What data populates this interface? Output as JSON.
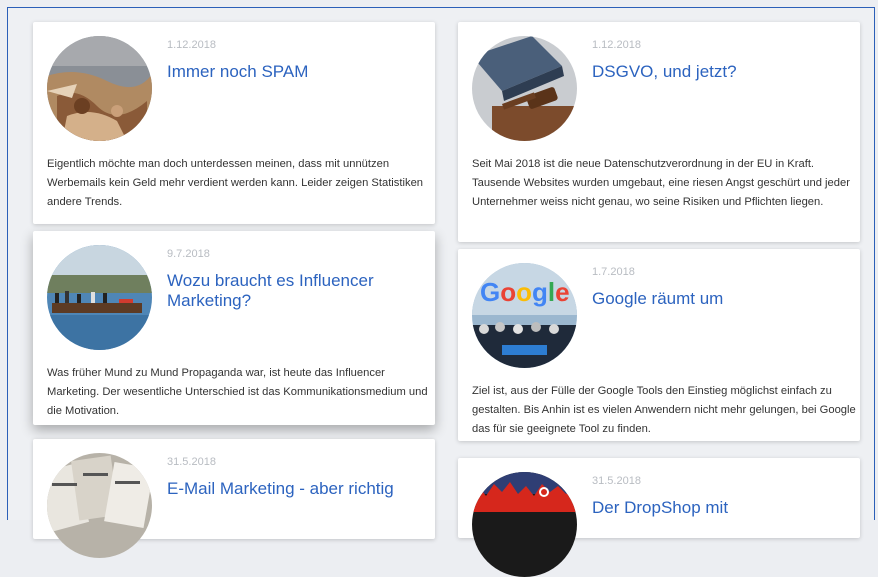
{
  "posts": [
    {
      "date": "1.12.2018",
      "title": "Immer noch SPAM",
      "excerpt": "Eigentlich möchte man doch unterdessen meinen, dass mit unnützen Werbemails kein Geld mehr verdient werden kann. Leider zeigen Statistiken andere Trends."
    },
    {
      "date": "1.12.2018",
      "title": "DSGVO, und jetzt?",
      "excerpt": "Seit Mai 2018 ist die neue Datenschutzverordnung in der EU in Kraft. Tausende Websites wurden umgebaut, eine riesen Angst geschürt und jeder Unternehmer weiss nicht genau, wo seine Risiken und Pflichten liegen."
    },
    {
      "date": "9.7.2018",
      "title": "Wozu braucht es Influencer Marketing?",
      "excerpt": "Was früher Mund zu Mund Propaganda war, ist heute das Influencer Marketing. Der wesentliche Unterschied ist das Kommunikationsmedium und die Motivation."
    },
    {
      "date": "1.7.2018",
      "title": "Google räumt um",
      "excerpt": "Ziel ist, aus der Fülle der Google Tools den Einstieg möglichst einfach zu gestalten. Bis Anhin ist es vielen Anwendern nicht mehr gelungen, bei Google das für sie geeignete Tool zu finden."
    },
    {
      "date": "31.5.2018",
      "title": "E-Mail Marketing - aber richtig",
      "excerpt": ""
    },
    {
      "date": "31.5.2018",
      "title": "Der DropShop mit",
      "excerpt": ""
    }
  ],
  "images": {
    "google_logo_text": "Google"
  }
}
